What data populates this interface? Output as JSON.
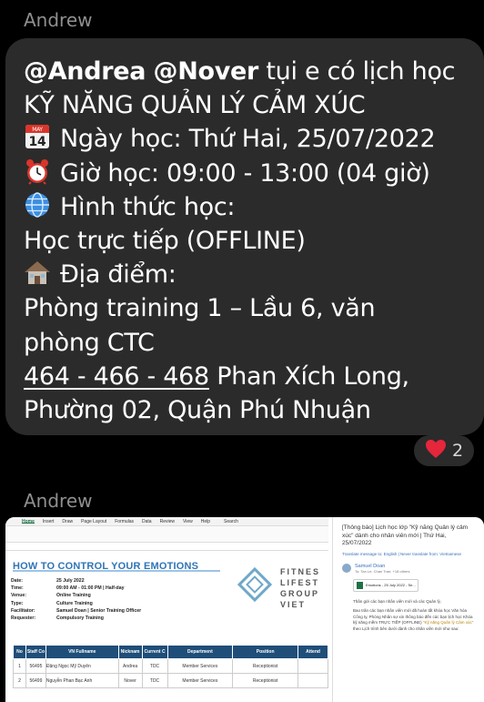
{
  "messages": [
    {
      "sender": "Andrew",
      "mention_1": "@Andrea",
      "mention_2": "@Nover",
      "intro": "tụi e có lịch học",
      "course": "KỸ NĂNG QUẢN LÝ CẢM XÚC",
      "calendar_month": "MAY",
      "calendar_day": "14",
      "date_line": "Ngày học: Thứ Hai, 25/07/2022",
      "time_line": "Giờ học: 09:00 - 13:00 (04 giờ)",
      "format_label": "Hình thức học:",
      "format_value": "Học trực tiếp (OFFLINE)",
      "location_label": "Địa điểm:",
      "location_line_1": "Phòng training 1 – Lầu 6, văn",
      "location_line_2": "phòng CTC",
      "address_link": "464 - 466 - 468",
      "address_rest": "Phan Xích Long,",
      "address_line_2": "Phường 02, Quận Phú Nhuận",
      "reaction_count": "2"
    },
    {
      "sender": "Andrew"
    }
  ],
  "attachment": {
    "ribbon_tabs": [
      "Home",
      "Insert",
      "Draw",
      "Page Layout",
      "Formulas",
      "Data",
      "Review",
      "View",
      "Help"
    ],
    "ribbon_search": "Search",
    "sheet_title": "HOW TO CONTROL YOUR EMOTIONS",
    "info": [
      {
        "k": "Date:",
        "v": "25 July 2022"
      },
      {
        "k": "Time:",
        "v": "09:00 AM - 01:00 PM | Half-day"
      },
      {
        "k": "Venue:",
        "v": "Online Training"
      },
      {
        "k": "Type:",
        "v": "Culture Training"
      },
      {
        "k": "Facilitator:",
        "v": "Samuel Doan | Senior Training Officer"
      },
      {
        "k": "Requester:",
        "v": "Compulsory Training"
      }
    ],
    "logo_lines": [
      "FITNES",
      "LIFEST",
      "GROUP VIET"
    ],
    "table_headers": [
      "No",
      "Staff Co",
      "VN Fullname",
      "Nicknam",
      "Current C",
      "Department",
      "Position",
      "Attend"
    ],
    "table_rows": [
      [
        "1",
        "56495",
        "Đặng Ngọc Mỹ Duyên",
        "Andrea",
        "TDC",
        "Member Services",
        "Receptionist",
        ""
      ],
      [
        "2",
        "56499",
        "Nguyễn Phan Bạc Anh",
        "Nover",
        "TDC",
        "Member Services",
        "Receptionist",
        ""
      ]
    ],
    "mail_subject": "[Thông báo] Lịch học lớp \"Kỹ năng Quản lý cảm xúc\" dành cho nhân viên mới | Thứ Hai, 25/07/2022",
    "mail_translate": "Translate message to: English | Never translate from: Vietnamese",
    "mail_sender": "Samuel Doan",
    "mail_to": "To: Tan Le; Chan Tran; +18 others",
    "mail_att_name": "Emotions - 25 July 2022 - Se...",
    "mail_greeting": "Thân gửi các bạn nhân viên mới và các Quản lý,",
    "mail_body_1": "Bao trân các bạn nhân viên mới đã hoàn tất khóa học Văn hóa Công ty, Phòng Nhân sự xin thông báo đến các bạn lịch học Khóa kỹ năng mềm TRỰC TIẾP (OFFLINE)",
    "mail_body_highlight": "\"Kỹ năng Quản lý Cảm xúc\"",
    "mail_body_2": "theo Lịch trình bên dưới dành cho nhân viên mới như sau:"
  }
}
